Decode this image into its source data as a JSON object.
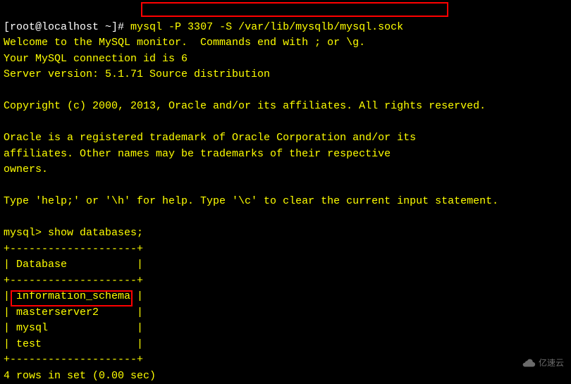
{
  "prompt": "[root@localhost ~]#",
  "command": "mysql -P 3307 -S /var/lib/mysqlb/mysql.sock",
  "welcome_line": "Welcome to the MySQL monitor.  Commands end with ; or \\g.",
  "connection_line": "Your MySQL connection id is 6",
  "version_line": "Server version: 5.1.71 Source distribution",
  "copyright_line": "Copyright (c) 2000, 2013, Oracle and/or its affiliates. All rights reserved.",
  "trademark_line1": "Oracle is a registered trademark of Oracle Corporation and/or its",
  "trademark_line2": "affiliates. Other names may be trademarks of their respective",
  "trademark_line3": "owners.",
  "help_line": "Type 'help;' or '\\h' for help. Type '\\c' to clear the current input statement.",
  "mysql_prompt": "mysql>",
  "query": "show databases;",
  "table": {
    "border": "+--------------------+",
    "header": "| Database           |",
    "rows": [
      "| information_schema |",
      "| masterserver2      |",
      "| mysql              |",
      "| test               |"
    ]
  },
  "result_line": "4 rows in set (0.00 sec)",
  "watermark_text": "亿速云"
}
